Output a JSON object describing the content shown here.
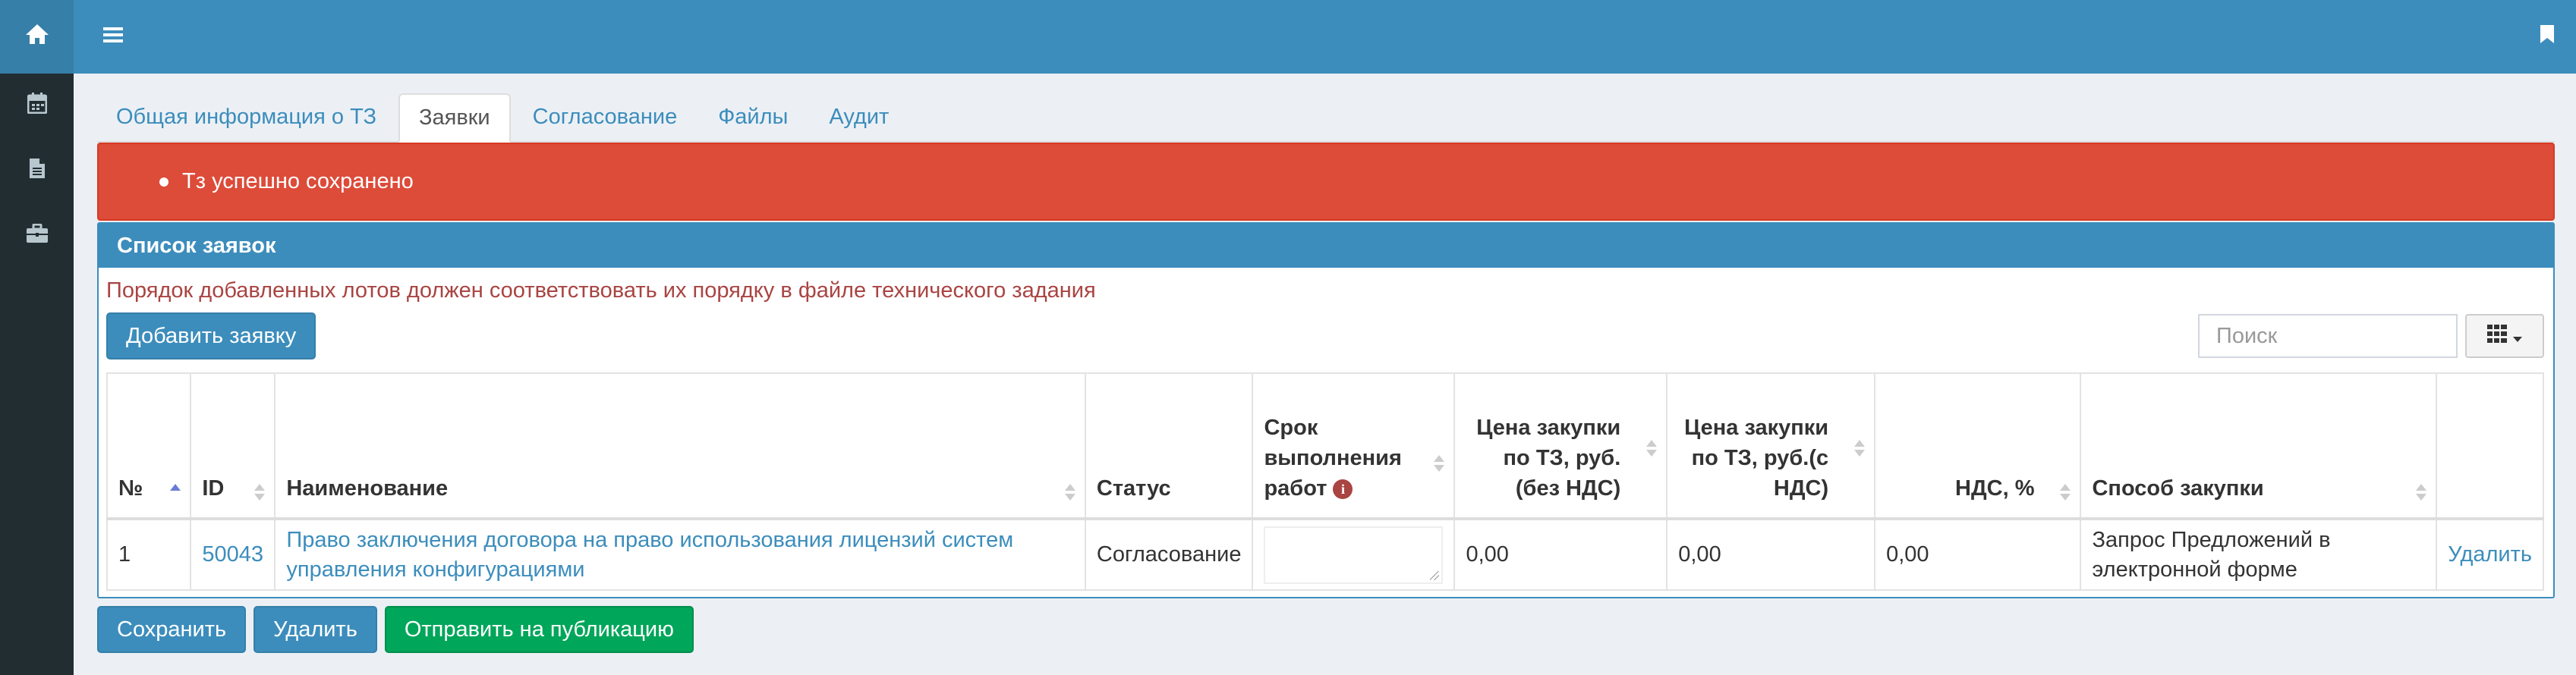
{
  "sidebar": {
    "items": [
      {
        "icon": "home-icon"
      },
      {
        "icon": "calendar-icon"
      },
      {
        "icon": "document-icon"
      },
      {
        "icon": "briefcase-icon"
      }
    ]
  },
  "tabs": [
    {
      "label": "Общая информация о ТЗ"
    },
    {
      "label": "Заявки"
    },
    {
      "label": "Согласование"
    },
    {
      "label": "Файлы"
    },
    {
      "label": "Аудит"
    }
  ],
  "alert": {
    "message": "Тз успешно сохранено"
  },
  "box": {
    "title": "Список заявок",
    "note": "Порядок добавленных лотов должен соответствовать их порядку в файле технического задания",
    "add_button": "Добавить заявку",
    "search_placeholder": "Поиск"
  },
  "table": {
    "headers": {
      "num": "№",
      "id": "ID",
      "name": "Наименование",
      "status": "Статус",
      "term": "Срок выполнения работ",
      "price_no_vat": "Цена закупки по ТЗ, руб.(без НДС)",
      "price_vat": "Цена закупки по ТЗ, руб.(с НДС)",
      "vat": "НДС, %",
      "method": "Способ закупки"
    },
    "rows": [
      {
        "num": "1",
        "id": "50043",
        "name": "Право заключения договора на право использования лицензий систем управления конфигурациями",
        "status": "Согласование",
        "term": "",
        "price_no_vat": "0,00",
        "price_vat": "0,00",
        "vat": "0,00",
        "method": "Запрос Предложений в электронной форме",
        "action": "Удалить"
      }
    ]
  },
  "footer": {
    "save": "Сохранить",
    "delete": "Удалить",
    "publish": "Отправить на публикацию"
  },
  "colors": {
    "header": "#3c8dbc",
    "sidebar": "#222d32",
    "alert": "#dd4b39",
    "success": "#00a65a"
  }
}
